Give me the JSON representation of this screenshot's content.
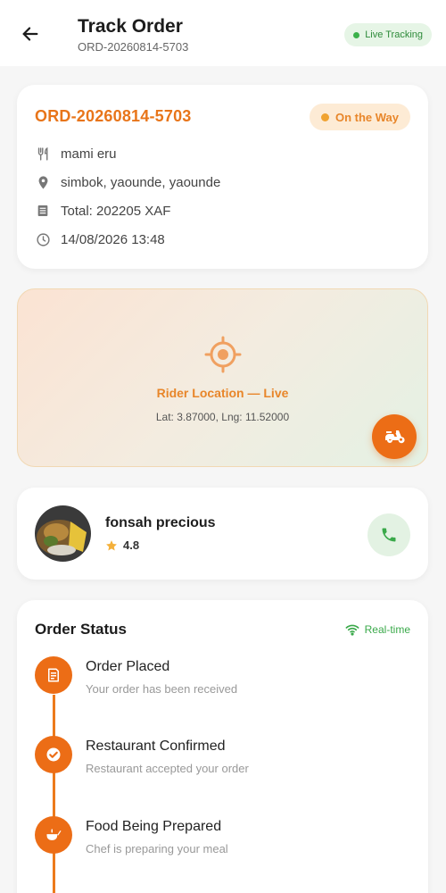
{
  "header": {
    "title": "Track Order",
    "order_ref": "ORD-20260814-5703",
    "live_label": "Live Tracking"
  },
  "order": {
    "id": "ORD-20260814-5703",
    "status": "On the Way",
    "restaurant": "mami eru",
    "address": "simbok, yaounde, yaounde",
    "total": "Total: 202205 XAF",
    "datetime": "14/08/2026 13:48"
  },
  "map": {
    "title": "Rider Location — Live",
    "coords": "Lat: 3.87000, Lng: 11.52000"
  },
  "rider": {
    "name": "fonsah precious",
    "rating": "4.8"
  },
  "status_section": {
    "title": "Order Status",
    "realtime_label": "Real-time",
    "steps": [
      {
        "title": "Order Placed",
        "desc": "Your order has been received",
        "icon": "receipt-icon"
      },
      {
        "title": "Restaurant Confirmed",
        "desc": "Restaurant accepted your order",
        "icon": "check-icon"
      },
      {
        "title": "Food Being Prepared",
        "desc": "Chef is preparing your meal",
        "icon": "cooking-pot-icon"
      }
    ]
  },
  "colors": {
    "accent": "#ec6d16",
    "accent_text": "#e8751a",
    "success": "#3aa94a",
    "pill_bg": "#fdebd5"
  }
}
